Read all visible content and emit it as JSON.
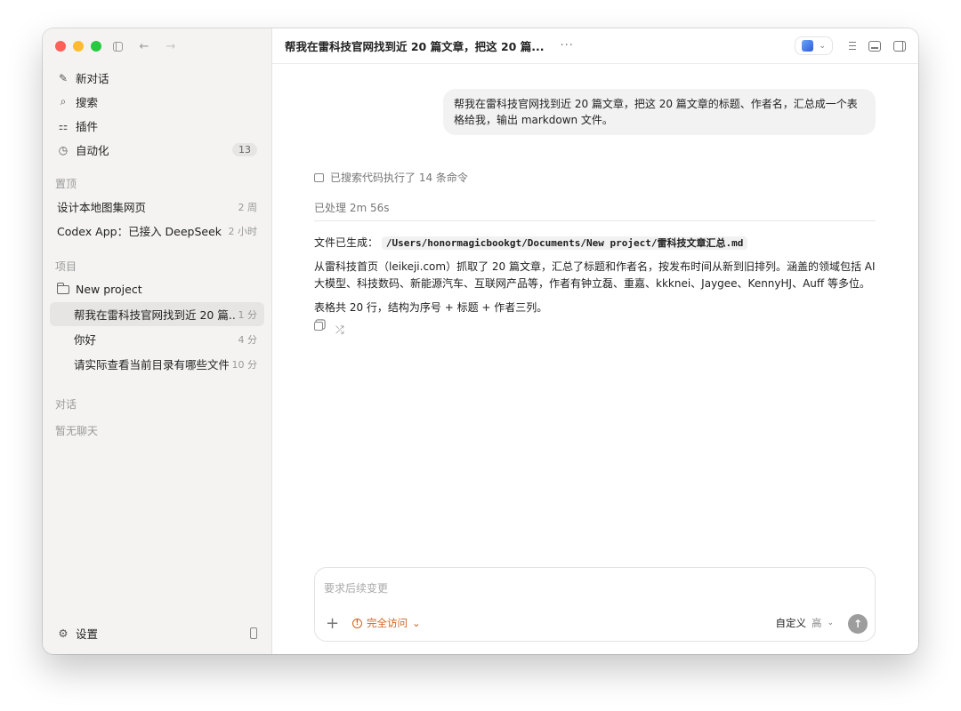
{
  "sidebar": {
    "nav": [
      {
        "label": "新对话",
        "icon": "edit-icon"
      },
      {
        "label": "搜索",
        "icon": "search-icon"
      },
      {
        "label": "插件",
        "icon": "plugins-icon"
      },
      {
        "label": "自动化",
        "icon": "clock-icon",
        "badge": "13"
      }
    ],
    "pinned_label": "置顶",
    "pinned": [
      {
        "title": "设计本地图集网页",
        "time": "2 周"
      },
      {
        "title": "Codex App：已接入 DeepSeek V...",
        "time": "2 小时"
      }
    ],
    "projects_label": "项目",
    "project_name": "New project",
    "threads": [
      {
        "title": "帮我在雷科技官网找到近 20 篇...",
        "time": "1 分"
      },
      {
        "title": "你好",
        "time": "4 分"
      },
      {
        "title": "请实际查看当前目录有哪些文件...",
        "time": "10 分"
      }
    ],
    "chats_label": "对话",
    "chats_empty": "暂无聊天",
    "settings_label": "设置"
  },
  "header": {
    "title": "帮我在雷科技官网找到近 20 篇文章，把这 20 篇...",
    "more": "···"
  },
  "conversation": {
    "user_message": "帮我在雷科技官网找到近 20 篇文章，把这 20 篇文章的标题、作者名，汇总成一个表格给我，输出 markdown 文件。",
    "searched_summary": "已搜索代码执行了 14 条命令",
    "processed": "已处理 2m 56s",
    "file_generated_label": "文件已生成：",
    "file_path": "/Users/honormagicbookgt/Documents/New project/雷科技文章汇总.md",
    "paragraph1": "从雷科技首页（leikeji.com）抓取了 20 篇文章，汇总了标题和作者名，按发布时间从新到旧排列。涵盖的领域包括 AI 大模型、科技数码、新能源汽车、互联网产品等，作者有钟立磊、重嘉、kkknei、Jaygee、KennyHJ、Auff 等多位。",
    "paragraph2": "表格共 20 行，结构为序号 + 标题 + 作者三列。"
  },
  "composer": {
    "placeholder": "要求后续变更",
    "access_label": "完全访问",
    "model_label": "自定义",
    "level_label": "高"
  },
  "colors": {
    "accent_warning": "#d0621e",
    "sidebar_bg": "#f4f3f2"
  }
}
